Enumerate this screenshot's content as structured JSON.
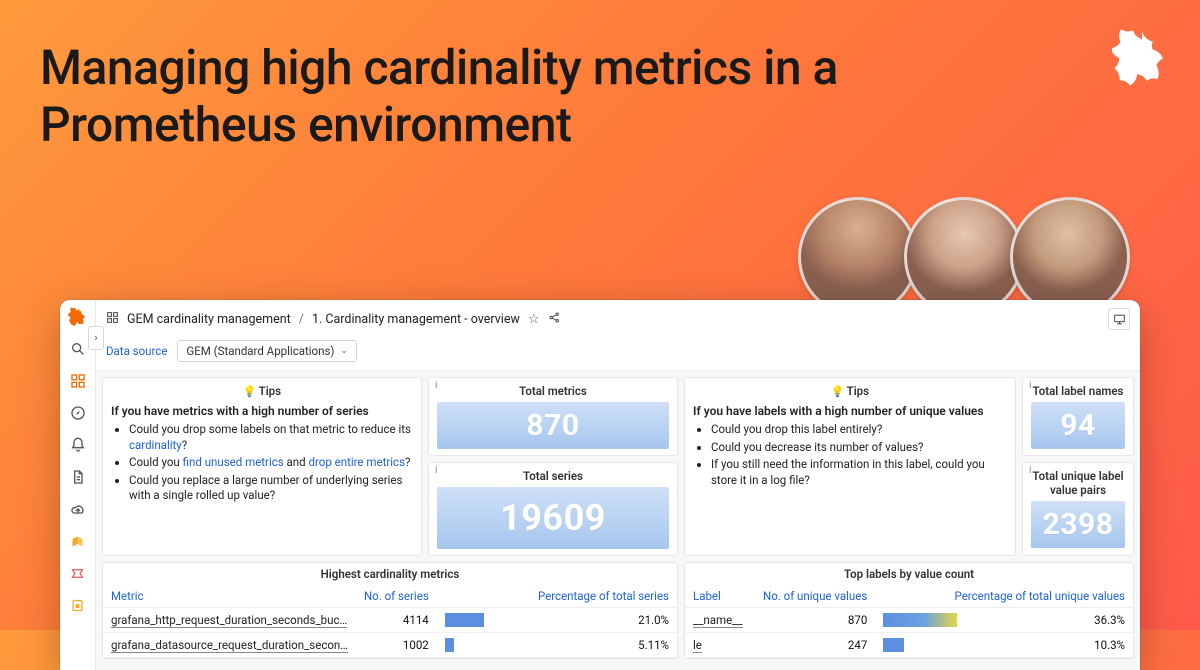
{
  "hero": {
    "title": "Managing high cardinality metrics in a Prometheus environment"
  },
  "breadcrumb": {
    "root": "GEM cardinality management",
    "page": "1. Cardinality management - overview"
  },
  "variable": {
    "label": "Data source",
    "value": "GEM (Standard Applications)"
  },
  "tips_metrics": {
    "title": "Tips",
    "lead": "If you have metrics with a high number of series",
    "b1a": "Could you drop some labels on that metric to reduce its ",
    "b1link": "cardinality",
    "b1b": "?",
    "b2a": "Could you ",
    "b2link1": "find unused metrics",
    "b2mid": " and ",
    "b2link2": "drop entire metrics",
    "b2b": "?",
    "b3": "Could you replace a large number of underlying series with a single rolled up value?"
  },
  "tips_labels": {
    "title": "Tips",
    "lead": "If you have labels with a high number of unique values",
    "b1": "Could you drop this label entirely?",
    "b2": "Could you decrease its number of values?",
    "b3": "If you still need the information in this label, could you store it in a log file?"
  },
  "stats": {
    "total_metrics_title": "Total metrics",
    "total_metrics": "870",
    "total_series_title": "Total series",
    "total_series": "19609",
    "total_label_names_title": "Total label names",
    "total_label_names": "94",
    "total_pairs_title": "Total unique label value pairs",
    "total_pairs": "2398"
  },
  "table_metrics": {
    "title": "Highest cardinality metrics",
    "h1": "Metric",
    "h2": "No. of series",
    "h3": "Percentage of total series",
    "rows": [
      {
        "metric": "grafana_http_request_duration_seconds_buc…",
        "series": "4114",
        "pct": "21.0%",
        "w": "21%"
      },
      {
        "metric": "grafana_datasource_request_duration_secon…",
        "series": "1002",
        "pct": "5.11%",
        "w": "5.11%"
      }
    ]
  },
  "table_labels": {
    "title": "Top labels by value count",
    "h1": "Label",
    "h2": "No. of unique values",
    "h3": "Percentage of total unique values",
    "rows": [
      {
        "label": "__name__",
        "vals": "870",
        "pct": "36.3%",
        "w": "36.3%",
        "grad": true
      },
      {
        "label": "le",
        "vals": "247",
        "pct": "10.3%",
        "w": "10.3%",
        "grad": false
      }
    ]
  }
}
